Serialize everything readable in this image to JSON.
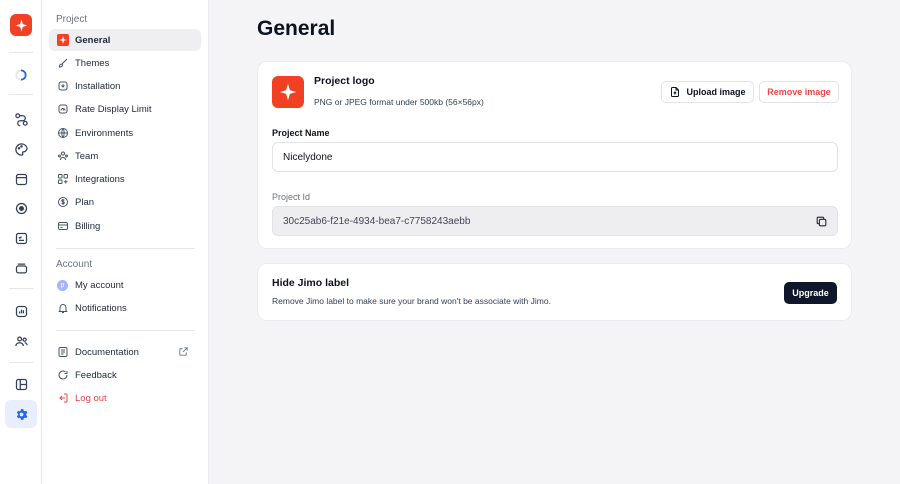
{
  "colors": {
    "brand": "#f24122",
    "accent": "#2563eb",
    "danger": "#ef4444",
    "dark_button": "#0f172a"
  },
  "rail": {
    "icons": [
      "brand-logo-icon",
      "loading-icon",
      "flow-icon",
      "palette-icon",
      "window-icon",
      "target-icon",
      "checklist-icon",
      "stack-icon",
      "analytics-icon",
      "users-icon",
      "layout-icon",
      "settings-icon"
    ]
  },
  "sidebar": {
    "project_heading": "Project",
    "project_items": [
      {
        "label": "General",
        "icon": "brand-logo-icon"
      },
      {
        "label": "Themes",
        "icon": "brush-icon"
      },
      {
        "label": "Installation",
        "icon": "install-icon"
      },
      {
        "label": "Rate Display Limit",
        "icon": "gauge-icon"
      },
      {
        "label": "Environments",
        "icon": "globe-icon"
      },
      {
        "label": "Team",
        "icon": "team-icon"
      },
      {
        "label": "Integrations",
        "icon": "integrations-icon"
      },
      {
        "label": "Plan",
        "icon": "dollar-icon"
      },
      {
        "label": "Billing",
        "icon": "card-icon"
      }
    ],
    "account_heading": "Account",
    "account_items": [
      {
        "label": "My account",
        "avatar_letter": "p"
      },
      {
        "label": "Notifications",
        "icon": "bell-icon"
      }
    ],
    "footer_items": [
      {
        "label": "Documentation",
        "icon": "docs-icon"
      },
      {
        "label": "Feedback",
        "icon": "feedback-icon"
      },
      {
        "label": "Log out",
        "icon": "logout-icon"
      }
    ]
  },
  "main": {
    "title": "General",
    "logo_card": {
      "title": "Project logo",
      "hint": "PNG or JPEG format under 500kb (56×56px)",
      "upload_label": "Upload image",
      "remove_label": "Remove image",
      "name_label": "Project Name",
      "name_value": "Nicelydone",
      "id_label": "Project Id",
      "id_value": "30c25ab6-f21e-4934-bea7-c7758243aebb"
    },
    "label_card": {
      "title": "Hide Jimo label",
      "description": "Remove Jimo label to make sure your brand won't be associate with Jimo.",
      "upgrade_label": "Upgrade"
    }
  }
}
